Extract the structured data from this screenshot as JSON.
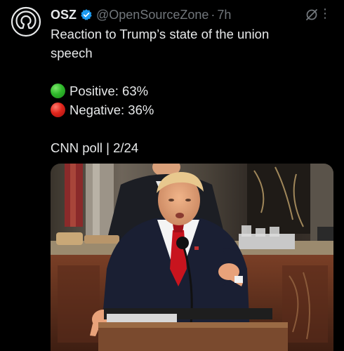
{
  "tweet": {
    "display_name": "OSZ",
    "handle": "@OpenSourceZone",
    "separator": "·",
    "time": "7h",
    "more_label": "⋮",
    "text_line1": "Reaction to Trump’s state of the union",
    "text_line2": "speech",
    "positive_label": "Positive: 63%",
    "negative_label": "Negative: 36%",
    "source_line": "CNN poll | 2/24",
    "icons": {
      "avatar": "open-source-logo-icon",
      "verified": "verified-badge-icon",
      "grok": "grok-icon",
      "more": "more-options-icon",
      "positive": "green-circle-icon",
      "negative": "red-circle-icon"
    },
    "colors": {
      "background": "#000000",
      "text": "#e7e9ea",
      "muted": "#71767b",
      "verified": "#1d9bf0"
    }
  },
  "media": {
    "icon": "tweet-photo"
  }
}
